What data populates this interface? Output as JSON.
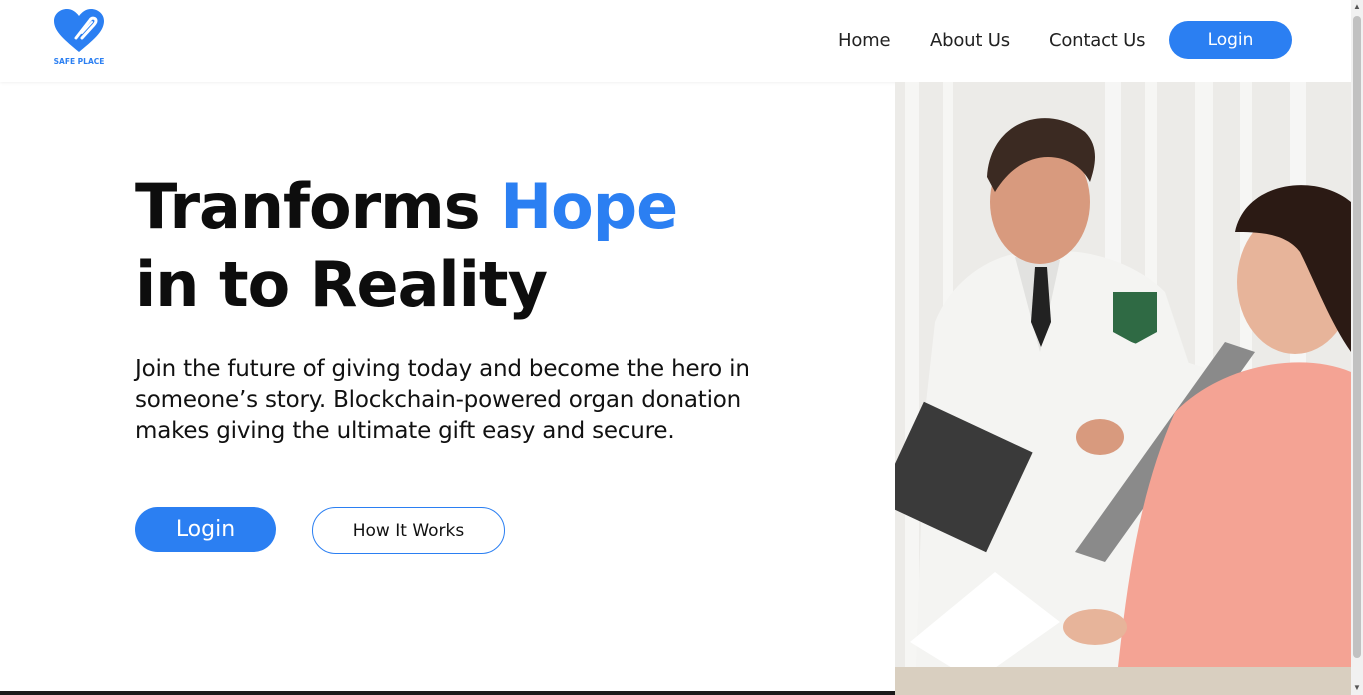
{
  "brand": {
    "name": "SAFE PLACE",
    "color": "#2b7ff2",
    "icon": "heart-logo-icon"
  },
  "nav": {
    "links": [
      {
        "label": "Home"
      },
      {
        "label": "About Us"
      },
      {
        "label": "Contact Us"
      }
    ],
    "login_label": "Login"
  },
  "hero": {
    "title_part1": "Tranforms ",
    "title_highlight": "Hope",
    "title_line2": "in to Reality",
    "description": "Join the future of giving today and become the hero in someone’s story. Blockchain-powered organ donation makes giving the ultimate gift easy and secure.",
    "login_label": "Login",
    "how_label": "How It Works",
    "image": "doctor-with-patient-photo"
  },
  "colors": {
    "accent": "#2b7ff2",
    "text": "#0d0d0d",
    "background": "#ffffff"
  }
}
